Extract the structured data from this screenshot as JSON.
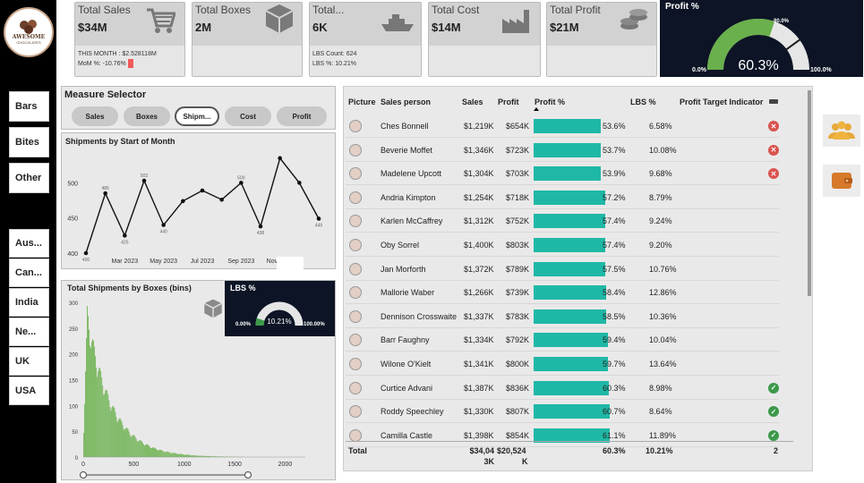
{
  "logo": {
    "line1": "AWESOME",
    "line2": "CHOCOLATES"
  },
  "slicers": {
    "products": [
      "Bars",
      "Bites",
      "Other"
    ],
    "countries": [
      "Aus...",
      "Can...",
      "India",
      "Ne...",
      "UK",
      "USA"
    ]
  },
  "cards": {
    "sales": {
      "label": "Total Sales",
      "value": "$34M",
      "line1": "THIS MONTH : $2.528118M",
      "line2": "MoM %: -10.76%"
    },
    "boxes": {
      "label": "Total Boxes",
      "value": "2M"
    },
    "shipments": {
      "label": "Total...",
      "value": "6K",
      "line1": "LBS Count: 624",
      "line2": "LBS %: 10.21%"
    },
    "cost": {
      "label": "Total Cost",
      "value": "$14M"
    },
    "profit": {
      "label": "Total Profit",
      "value": "$21M"
    }
  },
  "profit_gauge": {
    "title": "Profit %",
    "value": "60.3%",
    "min": "0.0%",
    "max": "100.0%",
    "target": "80.0%",
    "fraction": 0.603
  },
  "measure_selector": {
    "title": "Measure Selector",
    "options": [
      "Sales",
      "Boxes",
      "Shipm...",
      "Cost",
      "Profit"
    ],
    "active": 2
  },
  "line_chart": {
    "title": "Shipments by Start of Month"
  },
  "histogram": {
    "title": "Total Shipments by Boxes (bins)"
  },
  "lbs_gauge": {
    "title": "LBS %",
    "value": "10.21%",
    "min": "0.00%",
    "max": "100.00%",
    "fraction": 0.1021
  },
  "table": {
    "headers": [
      "Picture",
      "Sales person",
      "Sales",
      "Profit",
      "Profit %",
      "LBS %",
      "Profit Target Indicator"
    ],
    "rows": [
      {
        "name": "Ches Bonnell",
        "sales": "$1,219K",
        "profit": "$654K",
        "pct": "53.6%",
        "pctv": 53.6,
        "lbs": "6.58%",
        "ind": "x"
      },
      {
        "name": "Beverie Moffet",
        "sales": "$1,346K",
        "profit": "$723K",
        "pct": "53.7%",
        "pctv": 53.7,
        "lbs": "10.08%",
        "ind": "x"
      },
      {
        "name": "Madelene Upcott",
        "sales": "$1,304K",
        "profit": "$703K",
        "pct": "53.9%",
        "pctv": 53.9,
        "lbs": "9.68%",
        "ind": "x"
      },
      {
        "name": "Andria Kimpton",
        "sales": "$1,254K",
        "profit": "$718K",
        "pct": "57.2%",
        "pctv": 57.2,
        "lbs": "8.79%",
        "ind": ""
      },
      {
        "name": "Karlen McCaffrey",
        "sales": "$1,312K",
        "profit": "$752K",
        "pct": "57.4%",
        "pctv": 57.4,
        "lbs": "9.24%",
        "ind": ""
      },
      {
        "name": "Oby Sorrel",
        "sales": "$1,400K",
        "profit": "$803K",
        "pct": "57.4%",
        "pctv": 57.4,
        "lbs": "9.20%",
        "ind": ""
      },
      {
        "name": "Jan Morforth",
        "sales": "$1,372K",
        "profit": "$789K",
        "pct": "57.5%",
        "pctv": 57.5,
        "lbs": "10.76%",
        "ind": ""
      },
      {
        "name": "Mallorie Waber",
        "sales": "$1,266K",
        "profit": "$739K",
        "pct": "58.4%",
        "pctv": 58.4,
        "lbs": "12.86%",
        "ind": ""
      },
      {
        "name": "Dennison Crosswaite",
        "sales": "$1,337K",
        "profit": "$783K",
        "pct": "58.5%",
        "pctv": 58.5,
        "lbs": "10.36%",
        "ind": ""
      },
      {
        "name": "Barr Faughny",
        "sales": "$1,334K",
        "profit": "$792K",
        "pct": "59.4%",
        "pctv": 59.4,
        "lbs": "10.04%",
        "ind": ""
      },
      {
        "name": "Wilone O'Kielt",
        "sales": "$1,341K",
        "profit": "$800K",
        "pct": "59.7%",
        "pctv": 59.7,
        "lbs": "13.64%",
        "ind": ""
      },
      {
        "name": "Curtice Advani",
        "sales": "$1,387K",
        "profit": "$836K",
        "pct": "60.3%",
        "pctv": 60.3,
        "lbs": "8.98%",
        "ind": "ok"
      },
      {
        "name": "Roddy Speechley",
        "sales": "$1,330K",
        "profit": "$807K",
        "pct": "60.7%",
        "pctv": 60.7,
        "lbs": "8.64%",
        "ind": "ok"
      },
      {
        "name": "Camilla Castle",
        "sales": "$1,398K",
        "profit": "$854K",
        "pct": "61.1%",
        "pctv": 61.1,
        "lbs": "11.89%",
        "ind": "ok"
      }
    ],
    "total": {
      "label": "Total",
      "sales1": "$34,04",
      "sales2": "3K",
      "profit1": "$20,524",
      "profit2": "K",
      "pct": "60.3%",
      "lbs": "10.21%",
      "count": "2"
    }
  },
  "chart_data": [
    {
      "type": "line",
      "title": "Shipments by Start of Month",
      "x": [
        "Jan 2023",
        "Feb 2023",
        "Mar 2023",
        "Apr 2023",
        "May 2023",
        "Jun 2023",
        "Jul 2023",
        "Aug 2023",
        "Sep 2023",
        "Oct 2023",
        "Nov 2023",
        "Dec 2023",
        "Jan 2024",
        "Feb 2024"
      ],
      "values": [
        400,
        485,
        425,
        503,
        440,
        474,
        489,
        476,
        500,
        438,
        535,
        500,
        449
      ],
      "value_labels": [
        "400",
        "485",
        "425",
        "503",
        "440",
        "",
        "",
        "",
        "500",
        "438",
        "",
        "",
        "449"
      ],
      "xticks": [
        "Mar 2023",
        "May 2023",
        "Jul 2023",
        "Sep 2023",
        "Nov 2023"
      ],
      "yticks": [
        400,
        450,
        500
      ],
      "ylim": [
        400,
        545
      ]
    },
    {
      "type": "bar",
      "title": "Total Shipments by Boxes (bins)",
      "xticks": [
        0,
        500,
        1000,
        1500,
        2000
      ],
      "yticks": [
        0,
        50,
        100,
        150,
        200,
        250,
        300
      ],
      "xlim": [
        0,
        2200
      ],
      "ylim": [
        0,
        300
      ],
      "note": "right-skewed histogram peaking about 260 near 40 boxes, decaying to ~0 by 1500"
    }
  ],
  "colors": {
    "teal": "#1fb8a6",
    "green": "#6ab04c",
    "gaugeGreen": "#5cb85c",
    "navy": "#0c1425",
    "red": "#d9534f",
    "okGreen": "#3c9a4a",
    "orange": "#e08a2c"
  }
}
